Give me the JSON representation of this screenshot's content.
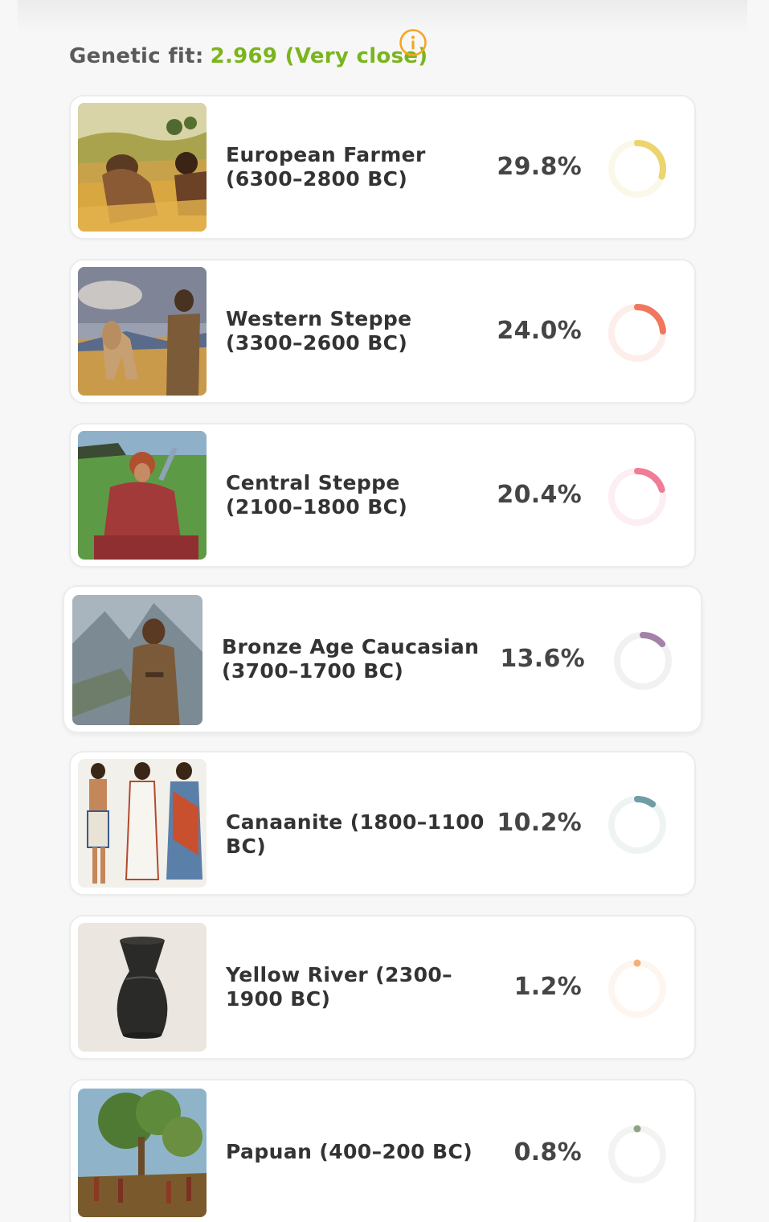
{
  "header": {
    "fit_label": "Genetic fit:",
    "fit_value": "2.969 (Very close)",
    "fit_color": "#7ab51d",
    "info_icon": "info-circle-icon",
    "info_color": "#f5a623"
  },
  "populations": [
    {
      "name": "European Farmer (6300–2800 BC)",
      "percent": "29.8%",
      "fraction": 0.298,
      "color": "#ecd46f",
      "track": "#fbf8ea",
      "image": "farmers-in-wheat-field-painting"
    },
    {
      "name": "Western Steppe (3300–2600 BC)",
      "percent": "24.0%",
      "fraction": 0.24,
      "color": "#f0775d",
      "track": "#fdeeea",
      "image": "man-with-horse-on-steppe-painting"
    },
    {
      "name": "Central Steppe (2100–1800 BC)",
      "percent": "20.4%",
      "fraction": 0.204,
      "color": "#f07d96",
      "track": "#fdeef1",
      "image": "woman-in-red-robe-on-grassland-painting"
    },
    {
      "name": "Bronze Age Caucasian (3700–1700 BC)",
      "percent": "13.6%",
      "fraction": 0.136,
      "color": "#a482a8",
      "track": "#f3f0f3",
      "image": "man-in-mountain-valley-painting"
    },
    {
      "name": "Canaanite (1800–1100 BC)",
      "percent": "10.2%",
      "fraction": 0.102,
      "color": "#6e9da6",
      "track": "#eef4f4",
      "image": "three-ancient-figures-illustration"
    },
    {
      "name": "Yellow River (2300–1900 BC)",
      "percent": "1.2%",
      "fraction": 0.012,
      "color": "#f4b07a",
      "track": "#fdf6f0",
      "image": "black-pottery-vase-photo"
    },
    {
      "name": "Papuan (400–200 BC)",
      "percent": "0.8%",
      "fraction": 0.008,
      "color": "#8fa487",
      "track": "#f2f4f1",
      "image": "tropical-forest-people-painting"
    }
  ]
}
